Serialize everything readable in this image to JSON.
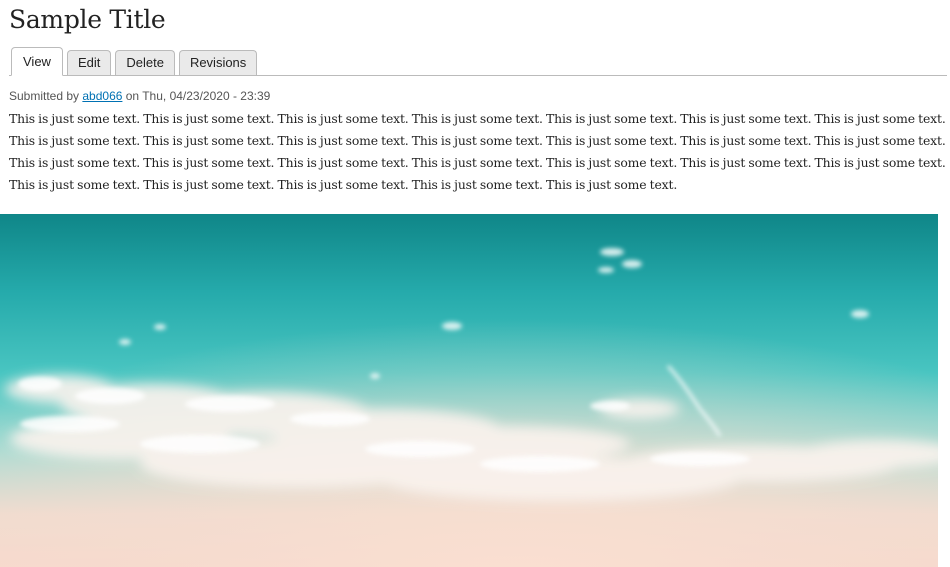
{
  "page": {
    "title": "Sample Title"
  },
  "tabs": [
    {
      "label": "View",
      "active": true
    },
    {
      "label": "Edit",
      "active": false
    },
    {
      "label": "Delete",
      "active": false
    },
    {
      "label": "Revisions",
      "active": false
    }
  ],
  "submitted": {
    "prefix": "Submitted by ",
    "author": "abd066",
    "suffix": " on Thu, 04/23/2020 - 23:39"
  },
  "content": {
    "body": "This is just some text. This is just some text. This is just some text. This is just some text. This is just some text. This is just some text. This is just some text. This is just some text. This is just some text. This is just some text. This is just some text. This is just some text. This is just some text. This is just some text. This is just some text. This is just some text. This is just some text. This is just some text. This is just some text. This is just some text. This is just some text. This is just some text. This is just some text. This is just some text. This is just some text. This is just some text."
  },
  "colors": {
    "link": "#0071b3",
    "sky_top": "#128a8e",
    "sky_mid": "#33c3c0",
    "sky_bottom": "#f6d9cc"
  }
}
